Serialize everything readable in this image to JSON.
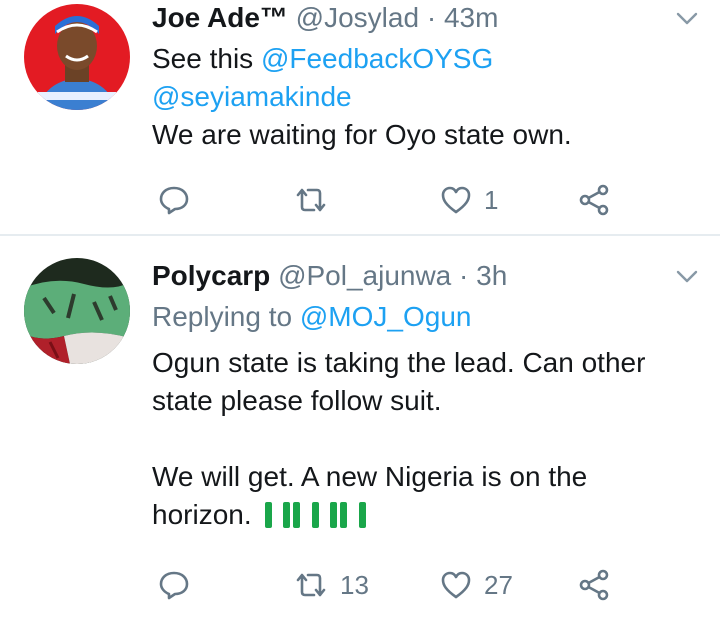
{
  "tweets": [
    {
      "name": "Joe Ade™",
      "handle": "@Josylad",
      "separator": "·",
      "time": "43m",
      "text_prefix": "See this ",
      "mention_1": "@FeedbackOYSG",
      "mention_2": "@seyiamakinde",
      "text_line": "We are waiting for Oyo state own.",
      "actions": {
        "reply_icon": "reply-icon",
        "retweet_icon": "retweet-icon",
        "like_icon": "heart-icon",
        "like_count": "1",
        "share_icon": "share-icon"
      }
    },
    {
      "name": "Polycarp",
      "handle": "@Pol_ajunwa",
      "separator": "·",
      "time": "3h",
      "reply_prefix": "Replying to ",
      "reply_target": "@MOJ_Ogun",
      "text_line_1": "Ogun state is taking the lead. Can other",
      "text_line_2": "state please follow suit.",
      "text_line_3": "We will get. A new Nigeria is on the",
      "text_line_4": "horizon.",
      "actions": {
        "reply_icon": "reply-icon",
        "retweet_icon": "retweet-icon",
        "retweet_count": "13",
        "like_icon": "heart-icon",
        "like_count": "27",
        "share_icon": "share-icon"
      }
    }
  ],
  "colors": {
    "link": "#1da1f2",
    "secondary": "#657786",
    "primary": "#14171a",
    "divider": "#e6ecf0"
  }
}
